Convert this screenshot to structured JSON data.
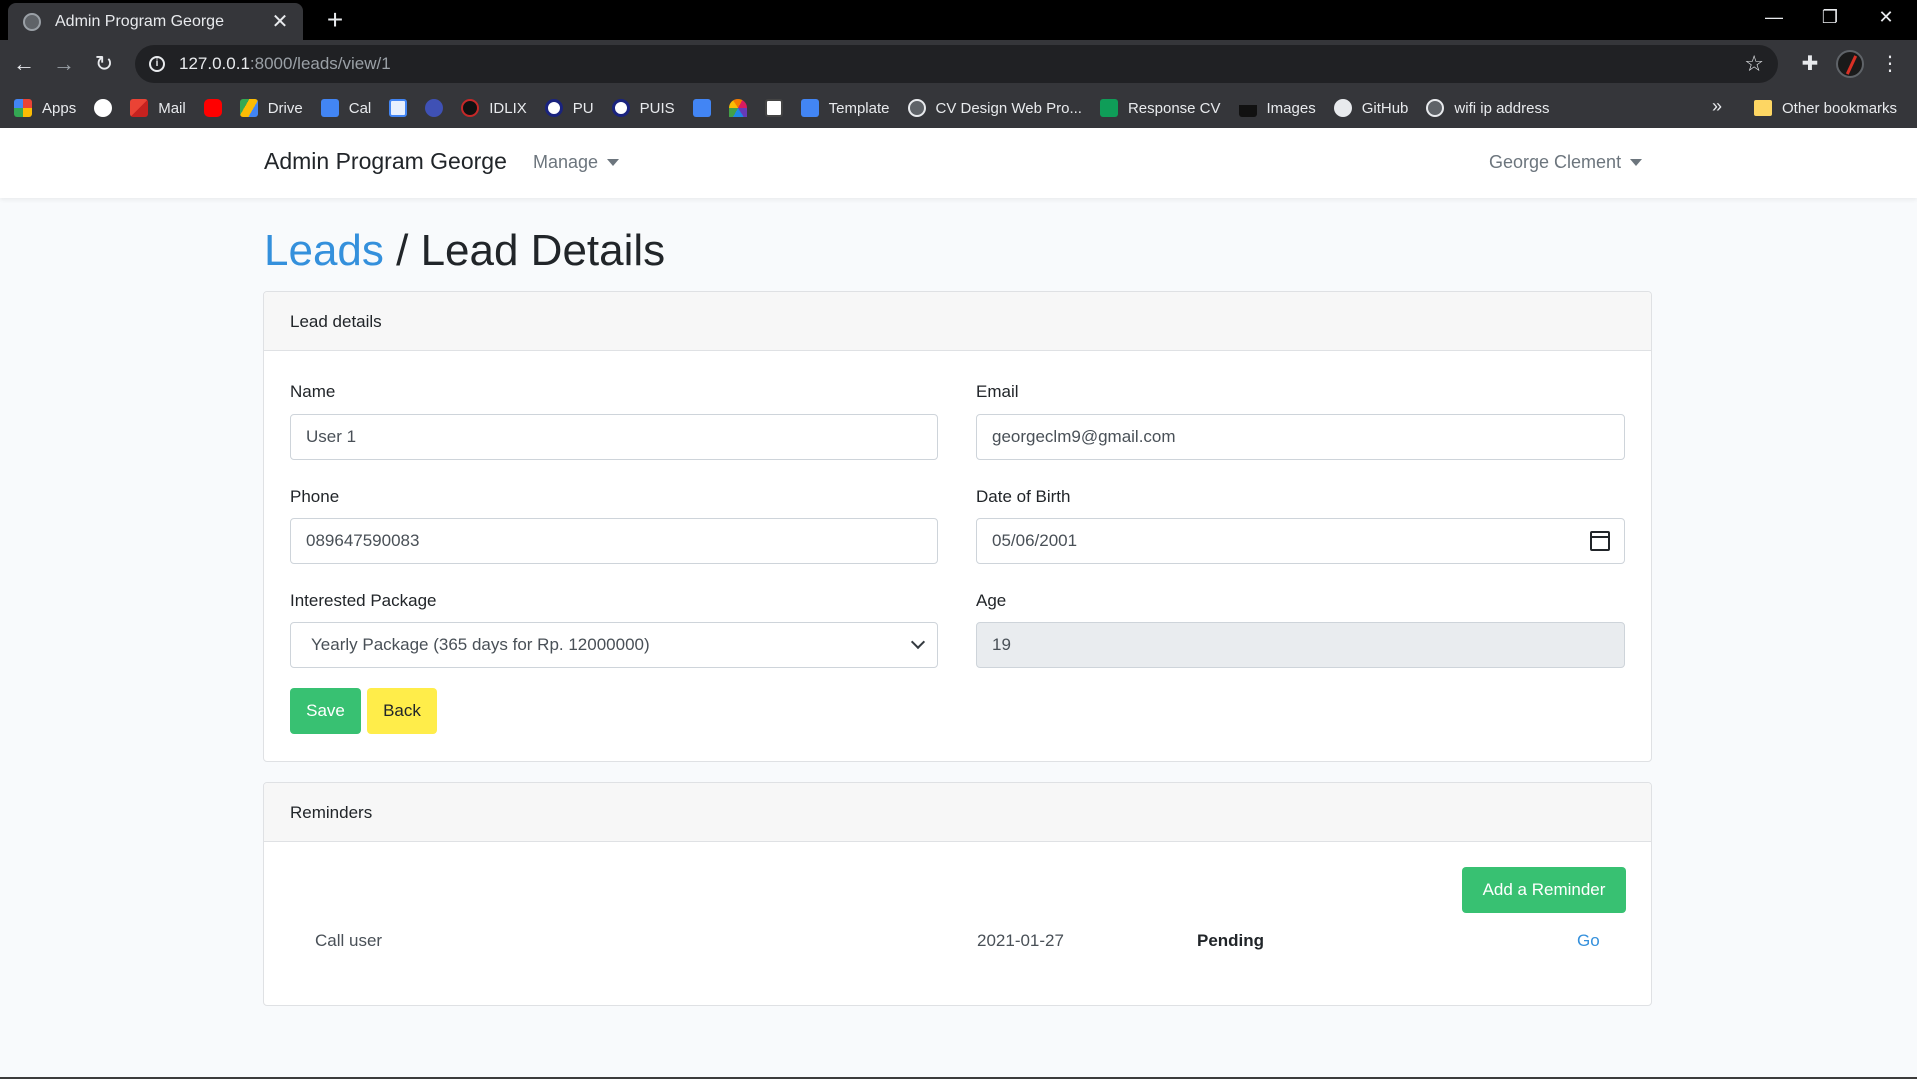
{
  "browser": {
    "tab_title": "Admin Program George",
    "url_host": "127.0.0.1",
    "url_path": ":8000/leads/view/1",
    "bookmarks": [
      "Apps",
      "Mail",
      "Drive",
      "Cal",
      "IDLIX",
      "PU",
      "PUIS",
      "Template",
      "CV Design Web Pro...",
      "Response CV",
      "Images",
      "GitHub",
      "wifi ip address"
    ],
    "other_bookmarks": "Other bookmarks",
    "more": "»"
  },
  "navbar": {
    "brand": "Admin Program George",
    "manage": "Manage",
    "user": "George Clement"
  },
  "breadcrumb": {
    "parent": "Leads",
    "separator": " / ",
    "current": "Lead Details"
  },
  "lead_card": {
    "header": "Lead details",
    "name_label": "Name",
    "name_value": "User 1",
    "email_label": "Email",
    "email_value": "georgeclm9@gmail.com",
    "phone_label": "Phone",
    "phone_value": "089647590083",
    "dob_label": "Date of Birth",
    "dob_value": "05/06/2001",
    "package_label": "Interested Package",
    "package_value": "Yearly Package (365 days for Rp. 12000000)",
    "age_label": "Age",
    "age_value": "19",
    "save_label": "Save",
    "back_label": "Back"
  },
  "reminders_card": {
    "header": "Reminders",
    "add_label": "Add a Reminder",
    "rows": [
      {
        "title": "Call user",
        "date": "2021-01-27",
        "status": "Pending",
        "action": "Go"
      }
    ]
  },
  "colors": {
    "link": "#3490dc",
    "success": "#38c172",
    "warning": "#ffed4a"
  }
}
